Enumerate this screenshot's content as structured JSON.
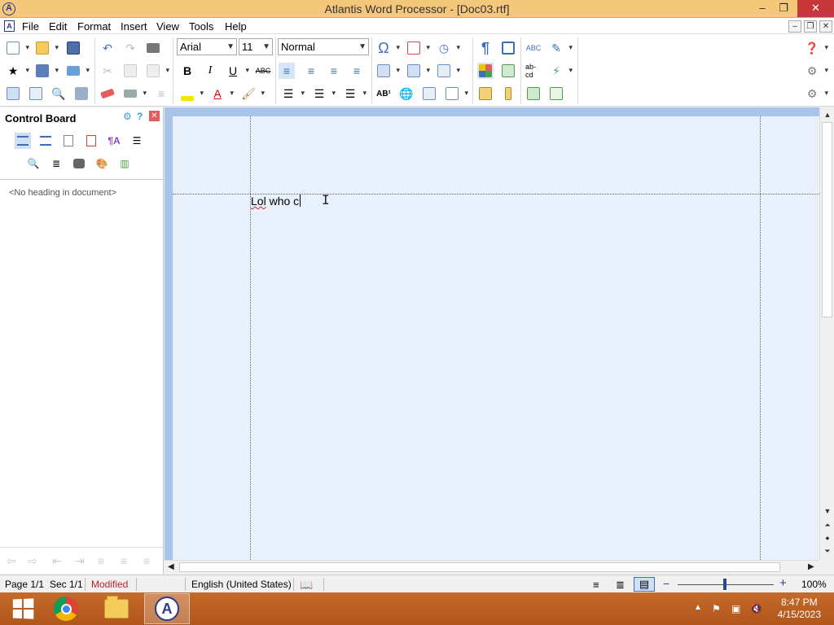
{
  "window": {
    "title": "Atlantis Word Processor - [Doc03.rtf]",
    "app_icon_letter": "A",
    "minimize": "–",
    "restore": "❐",
    "close": "✕"
  },
  "menubar": {
    "items": [
      "File",
      "Edit",
      "Format",
      "Insert",
      "View",
      "Tools",
      "Help"
    ],
    "mdi_minimize": "–",
    "mdi_restore": "❐",
    "mdi_close": "✕"
  },
  "toolbar": {
    "font_name": "Arial",
    "font_size": "11",
    "style": "Normal"
  },
  "control_board": {
    "title": "Control Board",
    "no_heading": "<No heading in document>"
  },
  "document": {
    "word1": "Lol",
    "rest": " who c"
  },
  "statusbar": {
    "page": "Page 1/1",
    "section": "Sec 1/1",
    "modified": "Modified",
    "language": "English (United States)",
    "zoom": "100%",
    "zoom_minus": "−",
    "zoom_plus": "+"
  },
  "taskbar": {
    "time": "8:47 PM",
    "date": "4/15/2023"
  },
  "colors": {
    "titlebar": "#f5c77a",
    "page": "#e8f1fb",
    "taskbar": "#c46a2a",
    "modified": "#c0202a"
  }
}
